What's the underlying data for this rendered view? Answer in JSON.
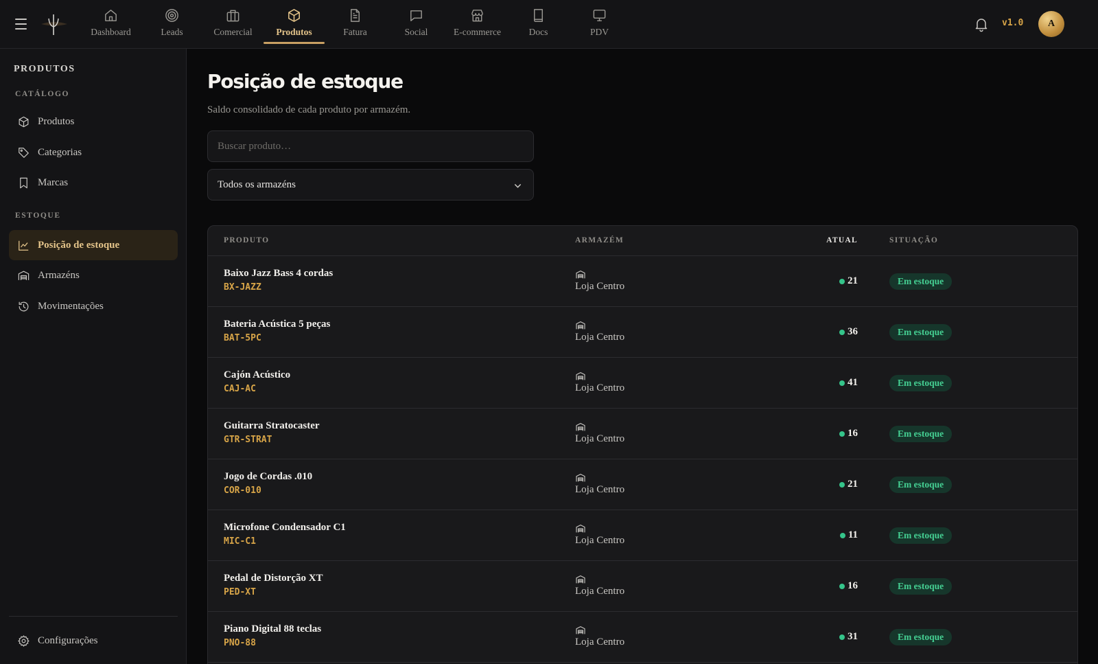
{
  "header": {
    "version": "v1.0",
    "avatar_initial": "A",
    "nav": [
      {
        "label": "Dashboard",
        "icon": "home-icon"
      },
      {
        "label": "Leads",
        "icon": "target-icon"
      },
      {
        "label": "Comercial",
        "icon": "briefcase-icon"
      },
      {
        "label": "Produtos",
        "icon": "box-icon",
        "active": true
      },
      {
        "label": "Fatura",
        "icon": "document-icon"
      },
      {
        "label": "Social",
        "icon": "chat-icon"
      },
      {
        "label": "E-commerce",
        "icon": "store-icon"
      },
      {
        "label": "Docs",
        "icon": "book-icon"
      },
      {
        "label": "PDV",
        "icon": "monitor-icon"
      }
    ],
    "accent_color": "#c9a063"
  },
  "sidebar": {
    "title": "PRODUTOS",
    "sections": [
      {
        "label": "CATÁLOGO"
      },
      {
        "label": "ESTOQUE"
      }
    ],
    "items": [
      {
        "label": "Produtos",
        "icon": "box-icon"
      },
      {
        "label": "Categorias",
        "icon": "tag-icon"
      },
      {
        "label": "Marcas",
        "icon": "bookmark-icon"
      },
      {
        "label": "Posição de estoque",
        "icon": "chart-line-icon",
        "active": true
      },
      {
        "label": "Armazéns",
        "icon": "warehouse-icon"
      },
      {
        "label": "Movimentações",
        "icon": "history-icon"
      }
    ],
    "footer": {
      "label": "Configurações",
      "icon": "gear-icon"
    }
  },
  "main": {
    "title": "Posição de estoque",
    "subtitle": "Saldo consolidado de cada produto por armazém.",
    "search": {
      "placeholder": "Buscar produto…",
      "value": ""
    },
    "warehouse_filter": {
      "selected": "Todos os armazéns"
    }
  },
  "table": {
    "columns": {
      "produto": "PRODUTO",
      "armazem": "ARMAZÉM",
      "atual": "ATUAL",
      "situacao": "SITUAÇÃO"
    },
    "rows": [
      {
        "name": "Baixo Jazz Bass 4 cordas",
        "sku": "BX-JAZZ",
        "warehouse": "Loja Centro",
        "qty": "21",
        "status": "Em estoque"
      },
      {
        "name": "Bateria Acústica 5 peças",
        "sku": "BAT-5PC",
        "warehouse": "Loja Centro",
        "qty": "36",
        "status": "Em estoque"
      },
      {
        "name": "Cajón Acústico",
        "sku": "CAJ-AC",
        "warehouse": "Loja Centro",
        "qty": "41",
        "status": "Em estoque"
      },
      {
        "name": "Guitarra Stratocaster",
        "sku": "GTR-STRAT",
        "warehouse": "Loja Centro",
        "qty": "16",
        "status": "Em estoque"
      },
      {
        "name": "Jogo de Cordas .010",
        "sku": "COR-010",
        "warehouse": "Loja Centro",
        "qty": "21",
        "status": "Em estoque"
      },
      {
        "name": "Microfone Condensador C1",
        "sku": "MIC-C1",
        "warehouse": "Loja Centro",
        "qty": "11",
        "status": "Em estoque"
      },
      {
        "name": "Pedal de Distorção XT",
        "sku": "PED-XT",
        "warehouse": "Loja Centro",
        "qty": "16",
        "status": "Em estoque"
      },
      {
        "name": "Piano Digital 88 teclas",
        "sku": "PNO-88",
        "warehouse": "Loja Centro",
        "qty": "31",
        "status": "Em estoque"
      }
    ],
    "status_color": "#45d093"
  }
}
